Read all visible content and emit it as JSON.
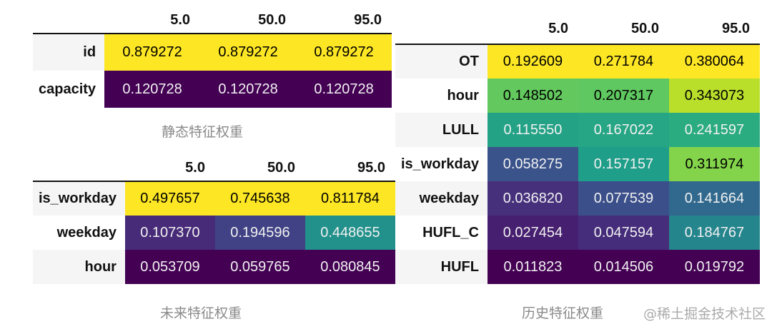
{
  "chart_data": [
    {
      "type": "heatmap",
      "caption": "静态特征权重",
      "columns": [
        "5.0",
        "50.0",
        "95.0"
      ],
      "rows": [
        "id",
        "capacity"
      ],
      "values": [
        [
          0.879272,
          0.879272,
          0.879272
        ],
        [
          0.120728,
          0.120728,
          0.120728
        ]
      ],
      "colormap": "viridis"
    },
    {
      "type": "heatmap",
      "caption": "未来特征权重",
      "columns": [
        "5.0",
        "50.0",
        "95.0"
      ],
      "rows": [
        "is_workday",
        "weekday",
        "hour"
      ],
      "values": [
        [
          0.497657,
          0.745638,
          0.811784
        ],
        [
          0.10737,
          0.194596,
          0.448655
        ],
        [
          0.053709,
          0.059765,
          0.080845
        ]
      ],
      "colormap": "viridis"
    },
    {
      "type": "heatmap",
      "caption": "历史特征权重",
      "columns": [
        "5.0",
        "50.0",
        "95.0"
      ],
      "rows": [
        "OT",
        "hour",
        "LULL",
        "is_workday",
        "weekday",
        "HUFL_C",
        "HUFL"
      ],
      "values": [
        [
          0.192609,
          0.271784,
          0.380064
        ],
        [
          0.148502,
          0.207317,
          0.343073
        ],
        [
          0.11555,
          0.167022,
          0.241597
        ],
        [
          0.058275,
          0.157157,
          0.311974
        ],
        [
          0.03682,
          0.077539,
          0.141664
        ],
        [
          0.027454,
          0.047594,
          0.184767
        ],
        [
          0.011823,
          0.014506,
          0.019792
        ]
      ],
      "colormap": "viridis"
    }
  ],
  "watermark": "@稀土掘金技术社区"
}
